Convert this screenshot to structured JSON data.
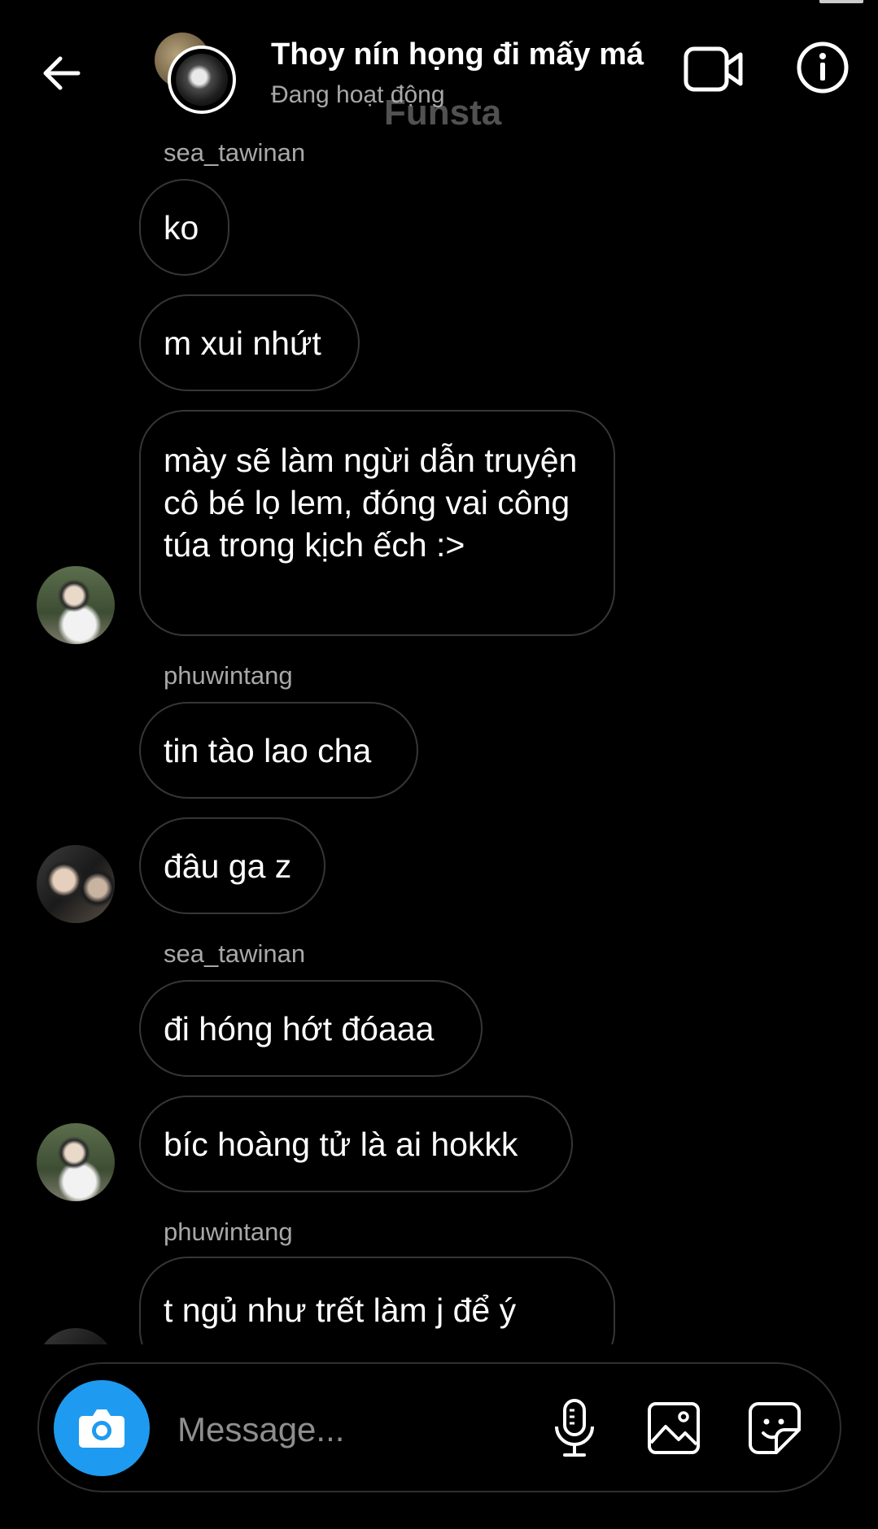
{
  "header": {
    "title": "Thoy nín họng đi mấy má",
    "status": "Đang hoạt động",
    "watermark": "Funsta"
  },
  "messages": [
    {
      "sender": "sea_tawinan",
      "text": "ko"
    },
    {
      "text": "m xui nhứt"
    },
    {
      "text": "mày sẽ làm ngừi dẫn truyện cô bé lọ lem, đóng vai công túa trong kịch ếch :>"
    },
    {
      "sender": "phuwintang",
      "text": "tin tào lao cha"
    },
    {
      "text": "đâu ga z"
    },
    {
      "sender": "sea_tawinan",
      "text": "đi hóng hớt đóaaa"
    },
    {
      "text": "bíc hoàng tử là ai hokkk"
    },
    {
      "sender": "phuwintang",
      "text": "t ngủ như trết làm j để ý"
    }
  ],
  "composer": {
    "placeholder": "Message..."
  },
  "icons": {
    "back": "arrow-left-icon",
    "video": "video-camera-icon",
    "info": "info-icon",
    "camera": "camera-icon",
    "mic": "microphone-icon",
    "gallery": "image-icon",
    "sticker": "sticker-icon"
  },
  "colors": {
    "background": "#000000",
    "bubble_border": "#363636",
    "accent": "#1e9bf0",
    "secondary_text": "#a8a8a8"
  }
}
